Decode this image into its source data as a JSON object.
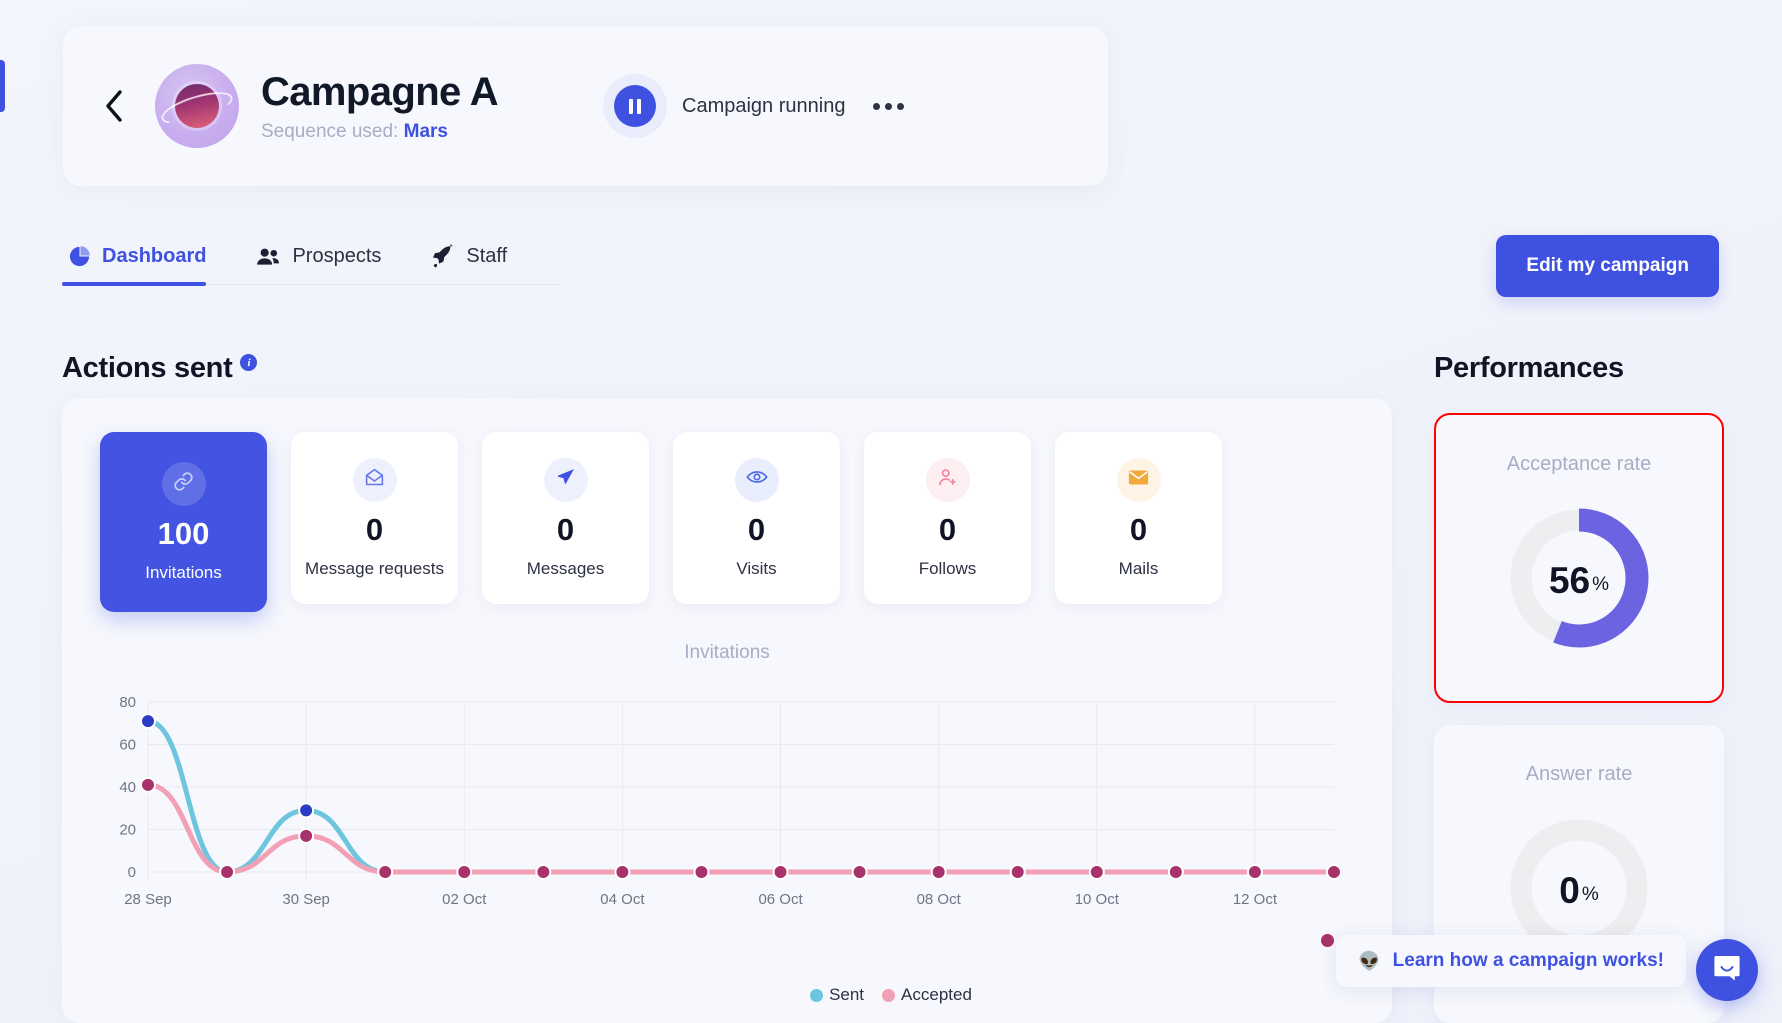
{
  "header": {
    "back_icon": "chevron-left-icon",
    "avatar_icon": "planet-avatar",
    "title": "Campagne A",
    "sequence_prefix": "Sequence used:",
    "sequence_name": "Mars",
    "pause_icon": "pause-icon",
    "status_text": "Campaign running",
    "more_icon": "ellipsis-icon"
  },
  "tabs": [
    {
      "label": "Dashboard",
      "icon": "pie-chart-icon",
      "active": true
    },
    {
      "label": "Prospects",
      "icon": "users-icon",
      "active": false
    },
    {
      "label": "Staff",
      "icon": "rocket-icon",
      "active": false
    }
  ],
  "edit_button": {
    "label": "Edit my campaign"
  },
  "actions": {
    "title": "Actions sent",
    "info_icon": "info-icon",
    "info_glyph": "i",
    "cards": [
      {
        "value": "100",
        "label": "Invitations",
        "icon": "link-icon",
        "selected": true,
        "icon_bg": "rgba(255,255,255,0.16)",
        "icon_color": "#c9d0f8"
      },
      {
        "value": "0",
        "label": "Message requests",
        "icon": "open-mail-icon",
        "selected": false,
        "icon_bg": "#eef1fd",
        "icon_color": "#6478ea"
      },
      {
        "value": "0",
        "label": "Messages",
        "icon": "paper-plane-icon",
        "selected": false,
        "icon_bg": "#eef1fd",
        "icon_color": "#3f51e0"
      },
      {
        "value": "0",
        "label": "Visits",
        "icon": "eye-icon",
        "selected": false,
        "icon_bg": "#e9eefc",
        "icon_color": "#4a68e8"
      },
      {
        "value": "0",
        "label": "Follows",
        "icon": "user-plus-icon",
        "selected": false,
        "icon_bg": "#fdeef1",
        "icon_color": "#f2809c"
      },
      {
        "value": "0",
        "label": "Mails",
        "icon": "envelope-icon",
        "selected": false,
        "icon_bg": "#fdf4e6",
        "icon_color": "#f2a93b"
      }
    ]
  },
  "chart_toolbar": [
    {
      "icon": "zoom-in-icon",
      "active": false
    },
    {
      "icon": "zoom-out-icon",
      "active": false
    },
    {
      "icon": "selection-zoom-icon",
      "active": true
    },
    {
      "icon": "pan-icon",
      "active": false
    },
    {
      "icon": "home-reset-icon",
      "active": false
    },
    {
      "icon": "menu-icon",
      "active": false
    }
  ],
  "chart_data": {
    "type": "line",
    "title": "Invitations",
    "xlabel": "",
    "ylabel": "",
    "ylim": [
      0,
      80
    ],
    "yticks": [
      "0",
      "20",
      "40",
      "60",
      "80"
    ],
    "grid": true,
    "legend_position": "bottom",
    "x": [
      "28 Sep",
      "29 Sep",
      "30 Sep",
      "01 Oct",
      "02 Oct",
      "03 Oct",
      "04 Oct",
      "05 Oct",
      "06 Oct",
      "07 Oct",
      "08 Oct",
      "09 Oct",
      "10 Oct",
      "11 Oct",
      "12 Oct",
      "13 Oct"
    ],
    "xticks": [
      "28 Sep",
      "30 Sep",
      "02 Oct",
      "04 Oct",
      "06 Oct",
      "08 Oct",
      "10 Oct",
      "12 Oct"
    ],
    "series": [
      {
        "name": "Sent",
        "color": "#6ec5de",
        "values": [
          71,
          0,
          29,
          0,
          0,
          0,
          0,
          0,
          0,
          0,
          0,
          0,
          0,
          0,
          0,
          0
        ]
      },
      {
        "name": "Accepted",
        "color": "#f2a0b5",
        "values": [
          41,
          0,
          17,
          0,
          0,
          0,
          0,
          0,
          0,
          0,
          0,
          0,
          0,
          0,
          0,
          0
        ]
      }
    ],
    "marker_colors": {
      "Sent": "#2a3bc4",
      "Accepted": "#a8336a"
    }
  },
  "performances": {
    "title": "Performances",
    "cards": [
      {
        "label": "Acceptance rate",
        "value": "56",
        "unit": "%",
        "percent": 56,
        "color": "#6c63e0",
        "track": "#eeeef0",
        "highlighted": true
      },
      {
        "label": "Answer rate",
        "value": "0",
        "unit": "%",
        "percent": 0,
        "color": "#6c63e0",
        "track": "#eeeef0",
        "highlighted": false
      }
    ]
  },
  "intercom": {
    "tip_emoji": "👽",
    "tip_text": "Learn how a campaign works!",
    "launcher_icon": "chat-bubble-icon"
  }
}
